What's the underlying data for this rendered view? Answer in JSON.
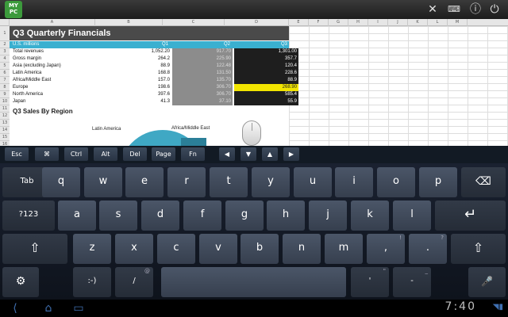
{
  "app": {
    "logo_line1": "MY",
    "logo_line2": "PC",
    "icons": [
      "close-icon",
      "keyboard-icon",
      "help-icon",
      "power-icon"
    ]
  },
  "sheet": {
    "columns": [
      "A",
      "B",
      "C",
      "D",
      "E",
      "F",
      "G",
      "H",
      "I",
      "J",
      "K",
      "L",
      "M"
    ],
    "row_numbers": [
      "1",
      "2",
      "3",
      "4",
      "5",
      "6",
      "7",
      "8",
      "9",
      "10",
      "11",
      "12",
      "13",
      "14",
      "15",
      "16"
    ],
    "title": "Q3 Quarterly Financials",
    "header": {
      "label": "U.S. millions",
      "q1": "Q1",
      "q2": "Q2",
      "q3": "Q3"
    },
    "rows": [
      {
        "label": "Total revenues",
        "q1": "1,052.20",
        "q2": "917.70",
        "q3": "1,301.00"
      },
      {
        "label": "Gross margin",
        "q1": "264.2",
        "q2": "225.90",
        "q3": "357.7"
      },
      {
        "label": "Asia  (excluding Japan)",
        "q1": "88.9",
        "q2": "122.48",
        "q3": "120.4"
      },
      {
        "label": "Latin America",
        "q1": "168.8",
        "q2": "131.50",
        "q3": "228.6"
      },
      {
        "label": "Africa/Middle East",
        "q1": "157.0",
        "q2": "135.70",
        "q3": "88.9"
      },
      {
        "label": "Europe",
        "q1": "198.6",
        "q2": "306.70",
        "q3": "268.90"
      },
      {
        "label": "North America",
        "q1": "397.6",
        "q2": "306.70",
        "q3": "585.4"
      },
      {
        "label": "Japan",
        "q1": "41.3",
        "q2": "37.10",
        "q3": "55.9"
      }
    ],
    "highlight_color": "#f2e500",
    "chart_title": "Q3 Sales By Region",
    "pie_labels": [
      "Latin America",
      "Africa/Middle East"
    ]
  },
  "extra_keys": [
    "Esc",
    "⌘",
    "Ctrl",
    "Alt",
    "Del",
    "Page",
    "Fn",
    "◀",
    "▼",
    "▲",
    "▶"
  ],
  "keyboard": {
    "row1": [
      "Tab",
      "q",
      "w",
      "e",
      "r",
      "t",
      "y",
      "u",
      "i",
      "o",
      "p",
      "⌫"
    ],
    "row2": [
      "?123",
      "a",
      "s",
      "d",
      "f",
      "g",
      "h",
      "j",
      "k",
      "l",
      "↵"
    ],
    "row3": [
      "⇧",
      "z",
      "x",
      "c",
      "v",
      "b",
      "n",
      "m",
      ",",
      ".",
      "⇧"
    ],
    "row3_alts": [
      "",
      "",
      "",
      "",
      "",
      "",
      "",
      "",
      "!",
      "?",
      ""
    ],
    "row4": [
      "⚙",
      ":-)",
      "/",
      "",
      "'",
      "-",
      "🎤"
    ],
    "row4_alts": [
      "",
      "",
      "@",
      "",
      "\"",
      "_",
      ""
    ]
  },
  "navbar": {
    "clock": "7:40",
    "icons": [
      "back-icon",
      "home-icon",
      "recent-apps-icon"
    ]
  }
}
